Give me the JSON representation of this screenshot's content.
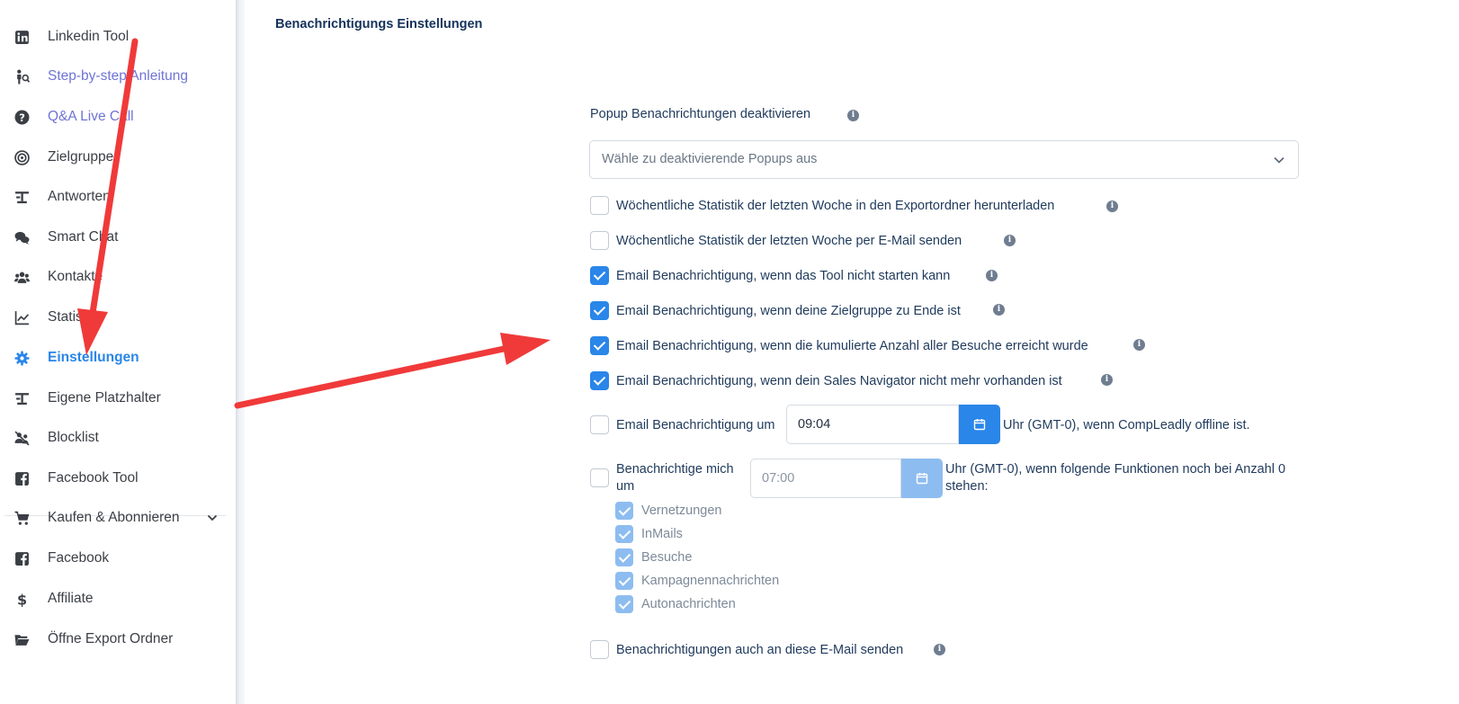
{
  "sidebar": {
    "items": [
      {
        "label": "Linkedin Tool",
        "icon": "linkedin-icon"
      },
      {
        "label": "Step-by-step Anleitung",
        "icon": "person-guide-icon"
      },
      {
        "label": "Q&A Live Call",
        "icon": "question-circle-icon"
      },
      {
        "label": "Zielgruppe",
        "icon": "target-icon"
      },
      {
        "label": "Antworten",
        "icon": "reply-icon"
      },
      {
        "label": "Smart Chat",
        "icon": "chat-icon"
      },
      {
        "label": "Kontakte",
        "icon": "users-icon"
      },
      {
        "label": "Statistik",
        "icon": "chart-line-icon"
      },
      {
        "label": "Einstellungen",
        "icon": "gear-icon"
      },
      {
        "label": "Eigene Platzhalter",
        "icon": "placeholder-icon"
      },
      {
        "label": "Blocklist",
        "icon": "block-users-icon"
      },
      {
        "label": "Facebook Tool",
        "icon": "facebook-icon"
      },
      {
        "label": "Kaufen & Abonnieren",
        "icon": "cart-icon"
      },
      {
        "label": "Facebook",
        "icon": "facebook-icon"
      },
      {
        "label": "Affiliate",
        "icon": "dollar-icon"
      },
      {
        "label": "Öffne Export Ordner",
        "icon": "folder-open-icon"
      }
    ]
  },
  "main": {
    "title": "Benachrichtigungs Einstellungen",
    "popup_label": "Popup Benachrichtungen deaktivieren",
    "popup_select_placeholder": "Wähle zu deaktivierende Popups aus",
    "options": [
      {
        "label": "Wöchentliche Statistik der letzten Woche in den Exportordner herunterladen",
        "checked": false
      },
      {
        "label": "Wöchentliche Statistik der letzten Woche per E-Mail senden",
        "checked": false
      },
      {
        "label": "Email Benachrichtigung, wenn das Tool nicht starten kann",
        "checked": true
      },
      {
        "label": "Email Benachrichtigung, wenn deine Zielgruppe zu Ende ist",
        "checked": true
      },
      {
        "label": "Email Benachrichtigung, wenn die kumulierte Anzahl aller Besuche erreicht wurde",
        "checked": true
      },
      {
        "label": "Email Benachrichtigung, wenn dein Sales Navigator nicht mehr vorhanden ist",
        "checked": true
      }
    ],
    "offline": {
      "label": "Email Benachrichtigung um",
      "time": "09:04",
      "suffix": "Uhr (GMT-0), wenn CompLeadly offline ist.",
      "checked": false
    },
    "notify": {
      "label_line1": "Benachrichtige mich",
      "label_line2": "um",
      "time": "07:00",
      "suffix_line1": "Uhr (GMT-0), wenn folgende Funktionen noch bei Anzahl 0",
      "suffix_line2": "stehen:",
      "checked": false,
      "functions": [
        "Vernetzungen",
        "InMails",
        "Besuche",
        "Kampagnennachrichten",
        "Autonachrichten"
      ]
    },
    "extra_email": {
      "label": "Benachrichtigungen auch an diese E-Mail senden",
      "checked": false
    }
  },
  "colors": {
    "accent": "#2a86e8",
    "arrow": "#f03a3a",
    "link": "#6f74d4",
    "title": "#14325a"
  }
}
